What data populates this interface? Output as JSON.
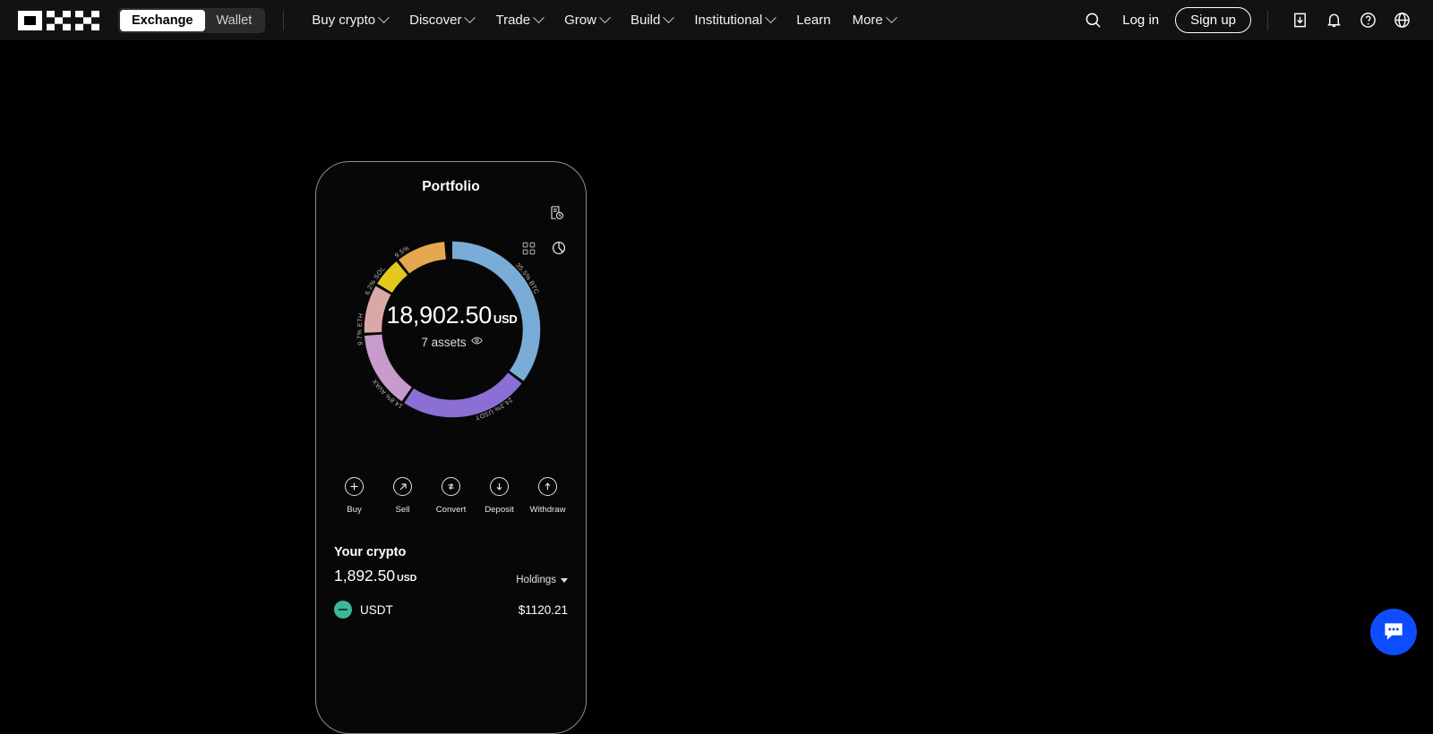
{
  "brand": {
    "name": "OKX",
    "logo_icon": "okx-logo"
  },
  "nav": {
    "segments": [
      {
        "label": "Exchange",
        "active": true
      },
      {
        "label": "Wallet",
        "active": false
      }
    ],
    "links": [
      {
        "label": "Buy crypto",
        "has_caret": true
      },
      {
        "label": "Discover",
        "has_caret": true
      },
      {
        "label": "Trade",
        "has_caret": true
      },
      {
        "label": "Grow",
        "has_caret": true
      },
      {
        "label": "Build",
        "has_caret": true
      },
      {
        "label": "Institutional",
        "has_caret": true
      },
      {
        "label": "Learn",
        "has_caret": false
      },
      {
        "label": "More",
        "has_caret": true
      }
    ],
    "search_icon": "search-icon",
    "login_label": "Log in",
    "signup_label": "Sign up",
    "right_icons": [
      {
        "name": "download-icon"
      },
      {
        "name": "bell-icon"
      },
      {
        "name": "help-circle-icon"
      },
      {
        "name": "globe-icon"
      }
    ]
  },
  "phone": {
    "title": "Portfolio",
    "header_icon": "transaction-history-icon",
    "view_toggles": [
      {
        "name": "grid-view-icon",
        "active": false
      },
      {
        "name": "pie-chart-view-icon",
        "active": true
      }
    ],
    "portfolio": {
      "total_value": "18,902.50",
      "currency": "USD",
      "assets_count_label": "7 assets",
      "eye_icon": "eye-icon"
    },
    "actions": [
      {
        "label": "Buy",
        "icon": "plus-circle-icon"
      },
      {
        "label": "Sell",
        "icon": "arrow-up-right-circle-icon"
      },
      {
        "label": "Convert",
        "icon": "convert-circle-icon"
      },
      {
        "label": "Deposit",
        "icon": "arrow-down-circle-icon"
      },
      {
        "label": "Withdraw",
        "icon": "arrow-up-circle-icon"
      }
    ],
    "your_crypto": {
      "title": "Your crypto",
      "amount": "1,892.50",
      "currency": "USD",
      "sort_label": "Holdings",
      "assets": [
        {
          "symbol": "USDT",
          "value": "$1120.21",
          "color": "#3fb699"
        }
      ]
    }
  },
  "chat": {
    "icon": "chat-bubble-icon",
    "color": "#0D4DFF"
  },
  "chart_data": {
    "type": "pie",
    "title": "Portfolio",
    "subtitle": "18,902.50 USD",
    "categories": [
      "BTC",
      "USDT",
      "AVAX",
      "ETH",
      "SOL",
      "",
      ""
    ],
    "values": [
      35.5,
      24.3,
      14.8,
      9.7,
      6.2,
      9.5
    ],
    "labels": [
      "35.5% BTC",
      "24.3% USDT",
      "14.8% AVAX",
      "9.7% ETH",
      "6.2% SOL",
      "9.5%"
    ],
    "colors": [
      "#79ADD8",
      "#8B6FD4",
      "#C79BCB",
      "#DBA8A8",
      "#E3C81E",
      "#E5A84F"
    ],
    "donut": true,
    "legend": "none",
    "grid": false
  }
}
